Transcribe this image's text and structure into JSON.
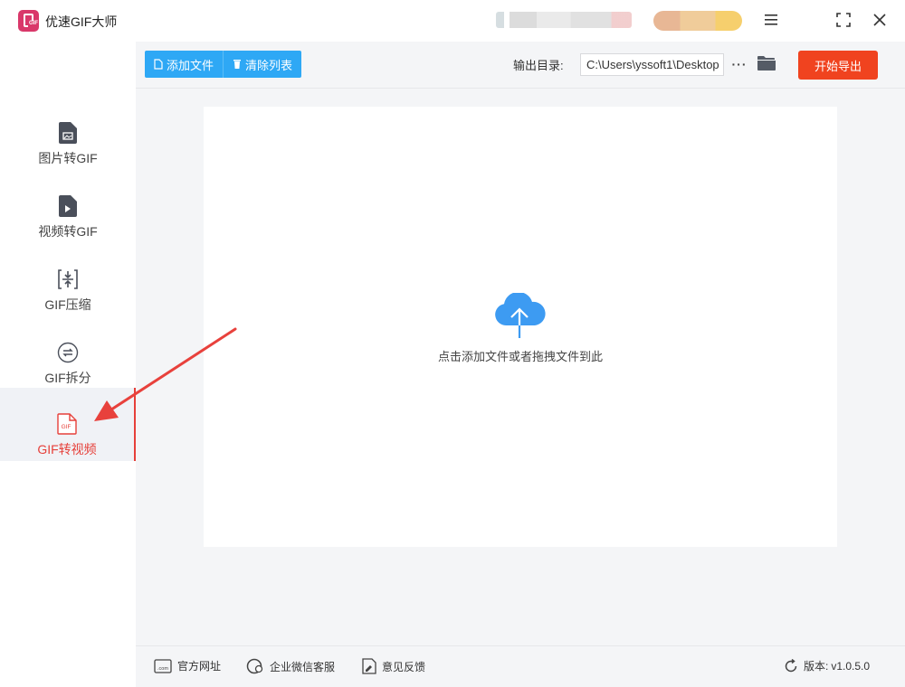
{
  "app": {
    "title": "优速GIF大师",
    "logo_tag": "GIF"
  },
  "window_controls": {
    "menu_icon": "hamburger-icon",
    "maximize_icon": "fullscreen-icon",
    "close_icon": "close-icon"
  },
  "sidebar": {
    "items": [
      {
        "label": "图片转GIF",
        "icon": "image-file-icon"
      },
      {
        "label": "视频转GIF",
        "icon": "video-file-icon"
      },
      {
        "label": "GIF压缩",
        "icon": "compress-icon"
      },
      {
        "label": "GIF拆分",
        "icon": "split-icon"
      },
      {
        "label": "GIF转视频",
        "icon": "gif-file-icon",
        "active": true
      }
    ],
    "gif_icon_text": "GIF"
  },
  "toolbar": {
    "add_file_label": "添加文件",
    "clear_list_label": "清除列表",
    "output_dir_label": "输出目录:",
    "output_dir_value": "C:\\Users\\yssoft1\\Desktop",
    "more_label": "···",
    "start_label": "开始导出"
  },
  "dropzone": {
    "hint": "点击添加文件或者拖拽文件到此"
  },
  "footer": {
    "website_label": "官方网址",
    "website_icon_text": ".com",
    "wechat_label": "企业微信客服",
    "feedback_label": "意见反馈",
    "version_label": "版本:",
    "version_value": "v1.0.5.0"
  },
  "colors": {
    "accent_blue": "#2ea8f5",
    "accent_red": "#e6403a",
    "start_button": "#f0431f",
    "cloud": "#3d9bf2"
  }
}
